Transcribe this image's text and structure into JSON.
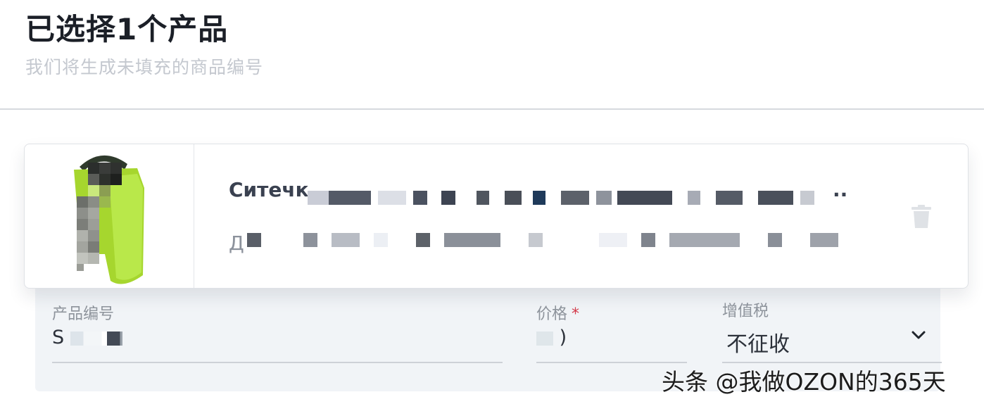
{
  "header": {
    "title": "已选择1个产品",
    "subtitle": "我们将生成未填充的商品编号"
  },
  "product": {
    "title_visible": "Ситечк",
    "title_tail": "..",
    "desc_visible": "Д",
    "image_icon": "product-image"
  },
  "icons": {
    "delete": "trash-icon",
    "dropdown": "chevron-down-icon"
  },
  "form": {
    "sku": {
      "label": "产品编号",
      "value": "S"
    },
    "price": {
      "label": "价格",
      "required_mark": "*",
      "value": ")"
    },
    "vat": {
      "label": "增值税",
      "value": "不征收"
    }
  },
  "watermark": "头条 @我做OZON的365天",
  "colors": {
    "title": "#1b1f27",
    "subtitle": "#c4c8cf",
    "panel_bg": "#f1f4f7",
    "required": "#d43a4a",
    "product_green": "#a6d62e"
  }
}
